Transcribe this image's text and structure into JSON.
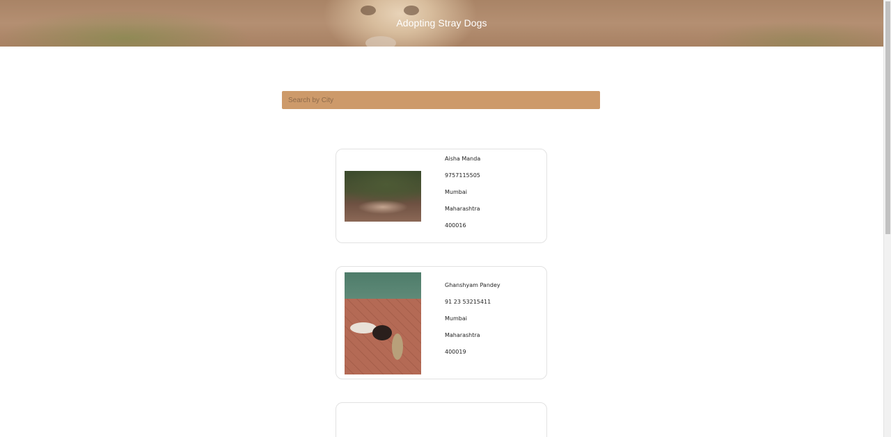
{
  "header": {
    "title": "Adopting Stray Dogs"
  },
  "search": {
    "placeholder": "Search by City",
    "value": ""
  },
  "listings": [
    {
      "name": "Aisha Manda",
      "phone": "9757115505",
      "city": "Mumbai",
      "state": "Maharashtra",
      "pincode": "400016"
    },
    {
      "name": "Ghanshyam Pandey",
      "phone": "91 23 53215411",
      "city": "Mumbai",
      "state": "Maharashtra",
      "pincode": "400019"
    }
  ],
  "colors": {
    "search_background": "#cd9a6a",
    "header_text": "#ffffff",
    "card_border": "#e2e2e2"
  }
}
